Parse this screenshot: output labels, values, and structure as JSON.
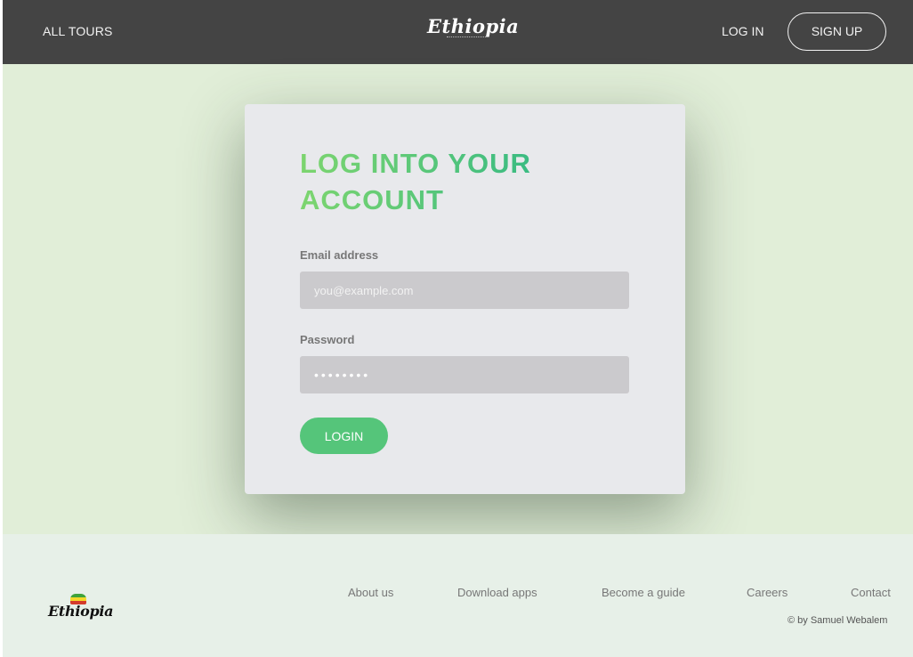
{
  "header": {
    "all_tours": "ALL TOURS",
    "logo_text": "Ethiopia",
    "log_in": "LOG IN",
    "sign_up": "SIGN UP"
  },
  "login_card": {
    "title": "LOG INTO YOUR ACCOUNT",
    "email_label": "Email address",
    "email_placeholder": "you@example.com",
    "email_value": "",
    "password_label": "Password",
    "password_value": "••••••••",
    "login_button": "LOGIN"
  },
  "footer": {
    "logo_text": "Ethiopia",
    "nav": [
      "About us",
      "Download apps",
      "Become a guide",
      "Careers",
      "Contact"
    ],
    "copyright": "© by Samuel Webalem"
  },
  "colors": {
    "header_bg": "#444444",
    "accent_green": "#55c57a",
    "main_bg": "#e1eed8",
    "card_bg": "#e8e9ec",
    "input_bg": "#cbcacd"
  },
  "icons": [
    "ethiopia-logo",
    "ethiopia-flag-map-icon"
  ]
}
